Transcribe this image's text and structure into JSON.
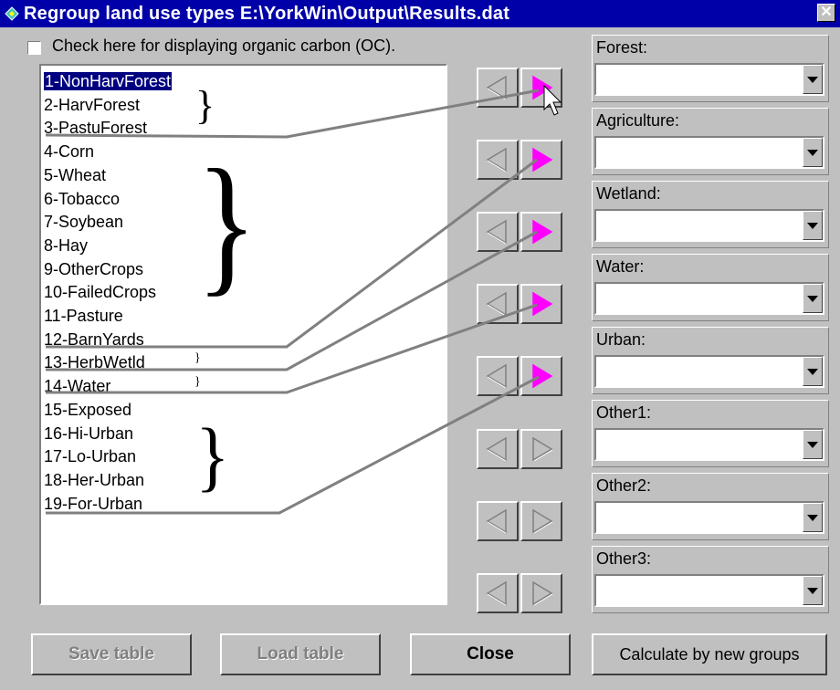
{
  "window": {
    "title": "Regroup land use types E:\\YorkWin\\Output\\Results.dat",
    "close_glyph": "✕"
  },
  "options": {
    "oc_checkbox_label": "Check here for displaying organic carbon (OC).",
    "oc_checked": false
  },
  "landuse_list": {
    "items": [
      "1-NonHarvForest",
      "2-HarvForest",
      "3-PastuForest",
      "4-Corn",
      "5-Wheat",
      "6-Tobacco",
      "7-Soybean",
      "8-Hay",
      "9-OtherCrops",
      "10-FailedCrops",
      "11-Pasture",
      "12-BarnYards",
      "13-HerbWetld",
      "14-Water",
      "15-Exposed",
      "16-Hi-Urban",
      "17-Lo-Urban",
      "18-Her-Urban",
      "19-For-Urban"
    ],
    "selected_index": 0
  },
  "arrow_buttons": [
    {
      "left_icon": "arrow-left-icon",
      "right_icon": "arrow-right-icon",
      "right_active": true
    },
    {
      "left_icon": "arrow-left-icon",
      "right_icon": "arrow-right-icon",
      "right_active": true
    },
    {
      "left_icon": "arrow-left-icon",
      "right_icon": "arrow-right-icon",
      "right_active": true
    },
    {
      "left_icon": "arrow-left-icon",
      "right_icon": "arrow-right-icon",
      "right_active": true
    },
    {
      "left_icon": "arrow-left-icon",
      "right_icon": "arrow-right-icon",
      "right_active": true
    },
    {
      "left_icon": "arrow-left-icon",
      "right_icon": "arrow-right-icon",
      "right_active": false
    },
    {
      "left_icon": "arrow-left-icon",
      "right_icon": "arrow-right-icon",
      "right_active": false
    },
    {
      "left_icon": "arrow-left-icon",
      "right_icon": "arrow-right-icon",
      "right_active": false
    }
  ],
  "groups": [
    {
      "label": "Forest:",
      "value": ""
    },
    {
      "label": "Agriculture:",
      "value": ""
    },
    {
      "label": "Wetland:",
      "value": ""
    },
    {
      "label": "Water:",
      "value": ""
    },
    {
      "label": "Urban:",
      "value": ""
    },
    {
      "label": "Other1:",
      "value": ""
    },
    {
      "label": "Other2:",
      "value": ""
    },
    {
      "label": "Other3:",
      "value": ""
    }
  ],
  "buttons": {
    "save_table": "Save table",
    "load_table": "Load table",
    "close": "Close",
    "calculate": "Calculate by new groups"
  },
  "colors": {
    "title_bar": "#0000a8",
    "arrow_active": "#ff00ff",
    "connector_line": "#808080",
    "selection": "#000080"
  }
}
